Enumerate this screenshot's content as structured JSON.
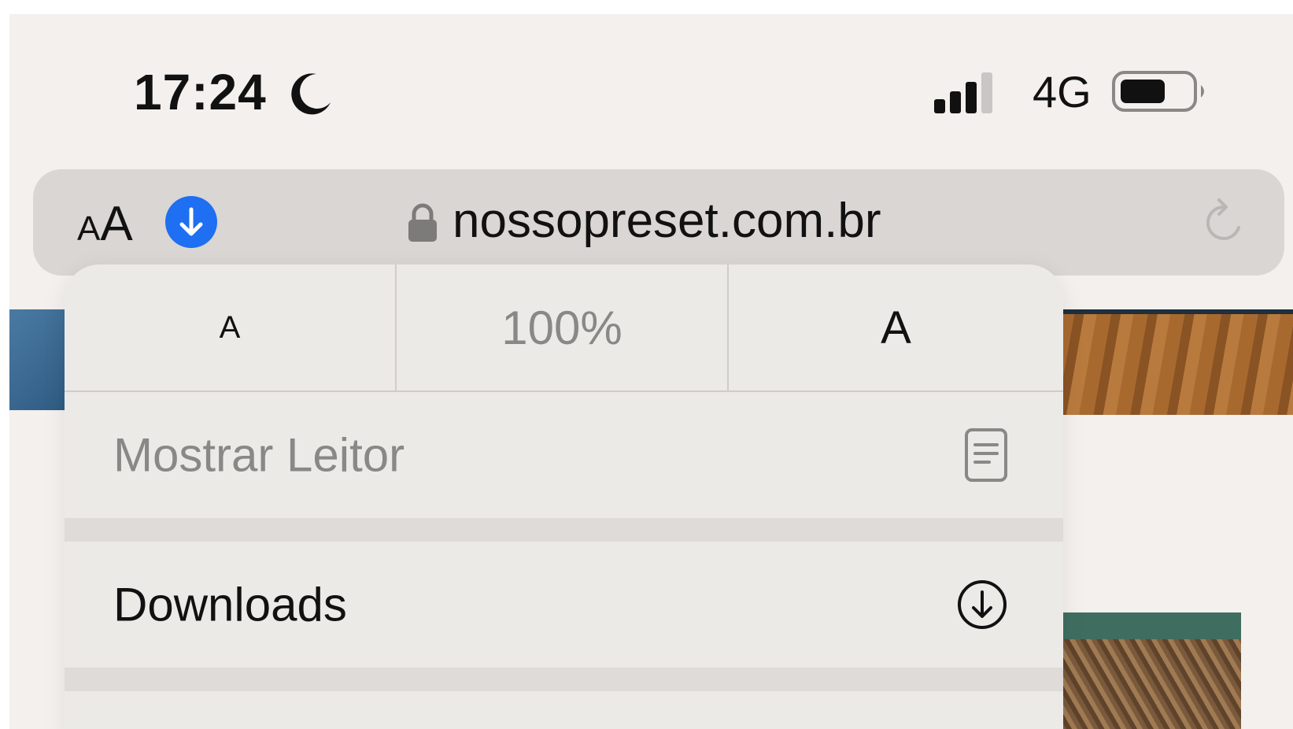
{
  "status_bar": {
    "time": "17:24",
    "network": "4G",
    "icons": [
      "moon-icon",
      "signal-icon",
      "battery-icon"
    ]
  },
  "address_bar": {
    "text_size_button": {
      "small": "A",
      "large": "A"
    },
    "url": "nossopreset.com.br",
    "icons": [
      "download-badge-icon",
      "lock-icon",
      "reload-icon"
    ],
    "accent_color": "#1e6ff2"
  },
  "popup": {
    "zoom": {
      "decrease_label": "A",
      "level": "100%",
      "increase_label": "A"
    },
    "items": [
      {
        "label": "Mostrar Leitor",
        "icon": "reader-icon",
        "enabled": false
      },
      {
        "label": "Downloads",
        "icon": "download-circle-icon",
        "enabled": true
      }
    ]
  }
}
